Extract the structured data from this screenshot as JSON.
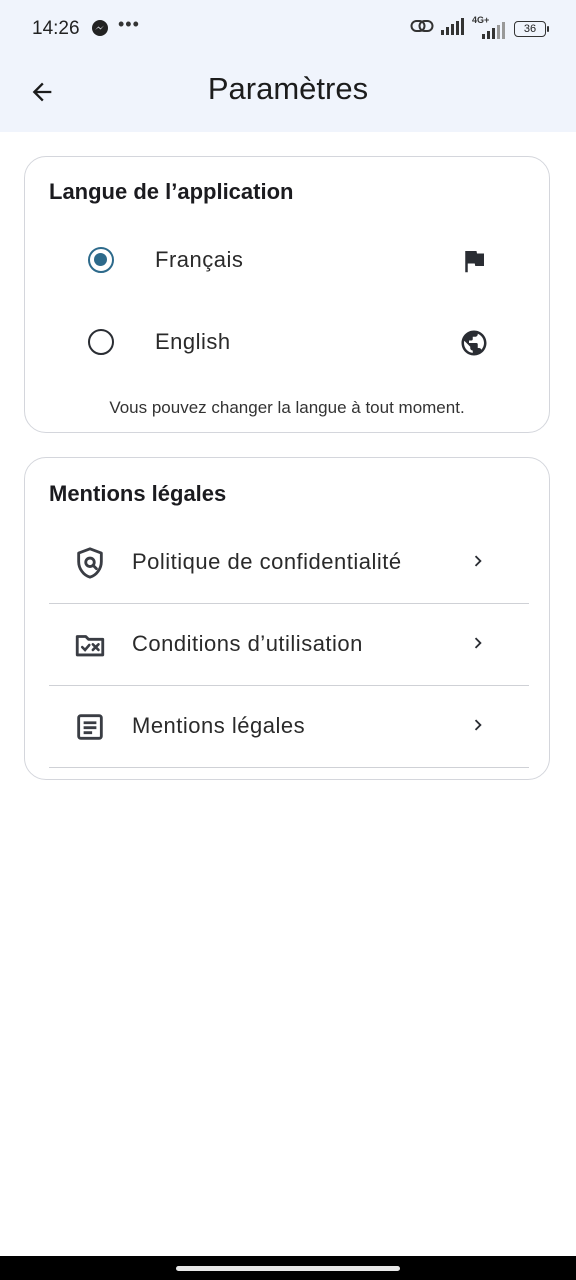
{
  "status_bar": {
    "time": "14:26",
    "network_label": "4G+",
    "battery": "36",
    "icons": [
      "messenger-icon",
      "more-icon",
      "link-icon",
      "signal-icon",
      "signal-4g-icon",
      "battery-icon"
    ]
  },
  "app_bar": {
    "title": "Paramètres",
    "back_icon": "arrow-back-icon"
  },
  "language_card": {
    "title": "Langue de l’application",
    "options": [
      {
        "label": "Français",
        "selected": true,
        "icon": "flag-icon"
      },
      {
        "label": "English",
        "selected": false,
        "icon": "globe-icon"
      }
    ],
    "note": "Vous pouvez changer la langue à tout moment."
  },
  "legal_card": {
    "title": "Mentions légales",
    "items": [
      {
        "label": "Politique de confidentialité",
        "icon": "shield-privacy-icon"
      },
      {
        "label": "Conditions d’utilisation",
        "icon": "folder-check-icon"
      },
      {
        "label": "Mentions légales",
        "icon": "document-icon"
      }
    ]
  },
  "colors": {
    "accent": "#2d6a8b",
    "app_bar_bg": "#f0f4fc",
    "card_border": "#d4d6dc"
  }
}
